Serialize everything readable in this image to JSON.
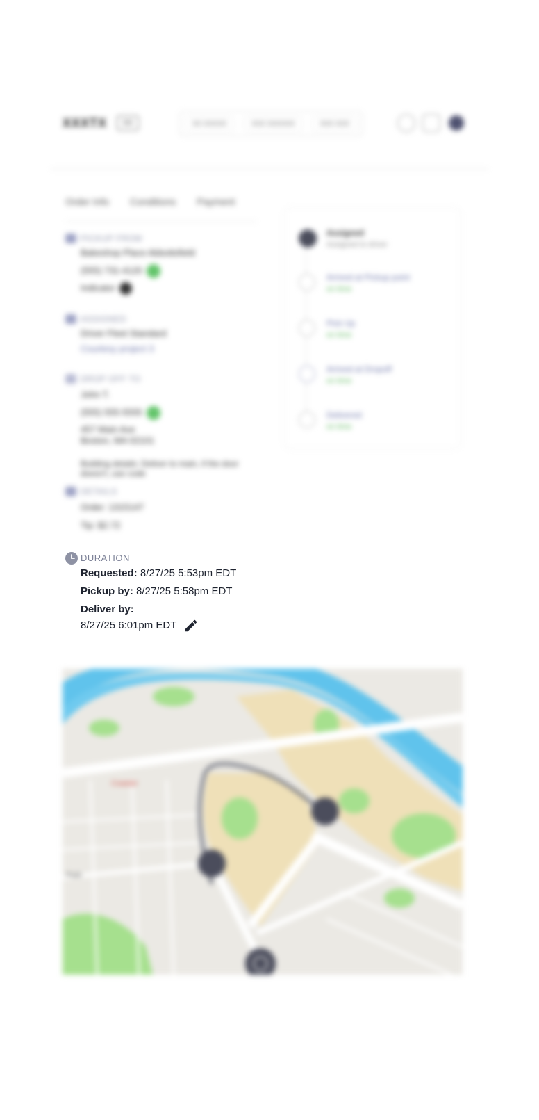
{
  "header": {
    "logo": "XXXTX",
    "badge": "XX",
    "nav": [
      "XX XXXXX",
      "XXX XXXXXX",
      "XXX XXX"
    ]
  },
  "tabs": [
    "Order Info",
    "Conditions",
    "Payment"
  ],
  "sections": {
    "pickup": {
      "title": "PICKUP FROM",
      "lines": [
        "Bakeshop Place Abbottsfield",
        "(555) 731-4120",
        "Indicator"
      ]
    },
    "assigned": {
      "title": "ASSIGNED",
      "lines": [
        "Driver Fleet Standard",
        "Courtesy project 3"
      ]
    },
    "dropoff": {
      "title": "DROP OFF TO",
      "lines": [
        "John T.",
        "(555) 555-5555",
        "457 Main Ave",
        "Boston, MA 02101"
      ],
      "note": "Building details: Deliver to main, if the door doesn't, use code"
    },
    "details": {
      "title": "DETAILS",
      "lines": [
        "Order: 1315147",
        "Tip: $2.72"
      ]
    }
  },
  "duration": {
    "title": "DURATION",
    "requested_label": "Requested:",
    "requested_value": "8/27/25 5:53pm EDT",
    "pickup_label": "Pickup by:",
    "pickup_value": "8/27/25 5:58pm EDT",
    "deliver_label": "Deliver by:",
    "deliver_value": "8/27/25 6:01pm EDT"
  },
  "status": [
    {
      "label": "Assigned",
      "sub": "Assigned to driver"
    },
    {
      "label": "Arrived at Pickup point",
      "sub": "on time"
    },
    {
      "label": "Pick Up",
      "sub": "on time"
    },
    {
      "label": "Arrived at Dropoff",
      "sub": "on time"
    },
    {
      "label": "Delivered",
      "sub": "on time"
    }
  ],
  "map": {
    "labels": [
      "Coaster",
      "Park"
    ]
  }
}
